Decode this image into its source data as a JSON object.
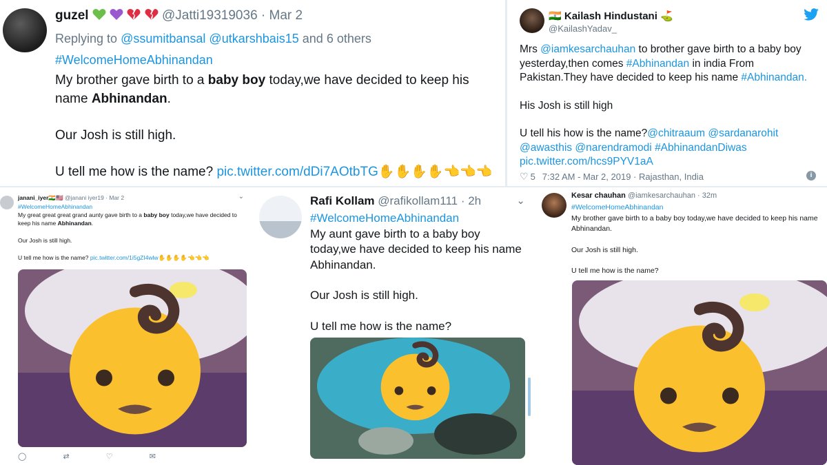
{
  "colors": {
    "link": "#1b95e0",
    "muted": "#657786",
    "emoji_yellow": "#fbc02d",
    "emoji_hair": "#4e342e"
  },
  "tweet1": {
    "name": "guzel",
    "name_emojis": [
      "green-heart",
      "purple-heart",
      "broken-heart",
      "broken-heart"
    ],
    "handle": "@Jatti19319036",
    "date": "· Mar 2",
    "reply_prefix": "Replying to",
    "reply_users": [
      "@ssumitbansal",
      "@utkarshbais15"
    ],
    "reply_suffix": "and 6 others",
    "hashtag": "#WelcomeHomeAbhinandan",
    "line1_a": "My brother gave birth to a",
    "line1_bold": "baby boy",
    "line1_b": "today,we have decided to keep his name",
    "line1_name": "Abhinandan",
    "line1_end": ".",
    "line2": "Our Josh is still high.",
    "line3_text": "U tell me how is the name?",
    "line3_link": "pic.twitter.com/dDi7AOtbTG",
    "line3_emojis": "✋✋✋✋👈👈👈"
  },
  "tweet2": {
    "flag": "🇮🇳",
    "name": "Kailash Hindustani",
    "name_emoji": "⛳",
    "handle": "@KailashYadav_",
    "p1_a": "Mrs",
    "p1_m1": "@iamkesarchauhan",
    "p1_b": "to brother gave birth to a baby boy yesterday,then comes",
    "p1_h1": "#Abhinandan",
    "p1_c": "in india From Pakistan.They have decided to keep his name",
    "p1_h2": "#Abhinandan.",
    "p2": "His Josh is still high",
    "p3_a": "U tell his how is the name?",
    "p3_m1": "@chitraaum",
    "p3_m2": "@sardanarohit",
    "p3_m3": "@awasthis",
    "p3_m4": "@narendramodi",
    "p3_h1": "#AbhinandanDiwas",
    "p3_link": "pic.twitter.com/hcs9PYV1aA",
    "likes": "5",
    "timestamp": "7:32 AM - Mar 2, 2019 · Rajasthan, India"
  },
  "tweet3": {
    "name": "janani_iyer",
    "name_flags": "🇮🇳🇺🇸",
    "handle": "@janani iyer19",
    "date": "· Mar 2",
    "hashtag": "#WelcomeHomeAbhinandan",
    "line1_a": "My great great great grand aunty  gave birth to a",
    "line1_bold": "baby boy",
    "line1_b": "today,we have decided to keep his name",
    "line1_name": "Abhinandan",
    "line1_end": ".",
    "line2": "Our Josh is still high.",
    "line3_text": "U tell me how is the name?",
    "line3_link": "pic.twitter.com/1i5gZI4wlw",
    "line3_emojis": "✋✋✋✋👈👈👈"
  },
  "tweet4": {
    "name": "Rafi Kollam",
    "handle": "@rafikollam111",
    "date": "· 2h",
    "hashtag": "#WelcomeHomeAbhinandan",
    "line1": "My aunt gave birth to a baby boy today,we have decided to keep his name Abhinandan.",
    "line2": "Our Josh is still high.",
    "line3": "U tell me how is the name?"
  },
  "tweet5": {
    "name": "Kesar chauhan",
    "handle": "@iamkesarchauhan",
    "date": "· 32m",
    "hashtag": "#WelcomeHomeAbhinandan",
    "line1": "My brother gave birth to a baby boy today,we have decided to keep his name Abhinandan.",
    "line2": "Our Josh is still high.",
    "line3": "U tell me how is the name?"
  }
}
